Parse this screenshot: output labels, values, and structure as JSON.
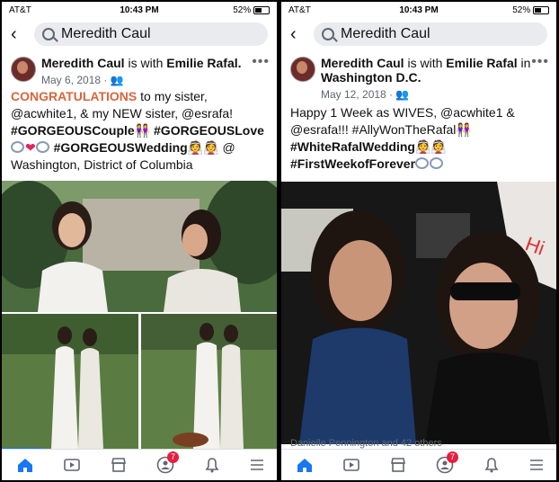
{
  "status": {
    "carrier": "AT&T",
    "time": "10:43 PM",
    "battery": "52%"
  },
  "search": {
    "query": "Meredith Caul"
  },
  "left": {
    "author": "Meredith Caul",
    "with_word": " is with ",
    "tagged": "Emilie Rafal.",
    "date": "May 6, 2018 · ",
    "text_congrats": "CONGRATULATIONS",
    "text_1": " to my sister, @acwhite1, & my NEW sister, @esrafa!",
    "tag_couple": "#GORGEOUSCouple",
    "tag_love": " #GORGEOUSLove",
    "tag_wedding": " #GORGEOUSWedding",
    "at": " @",
    "location": "Washington, District of Columbia"
  },
  "right": {
    "author": "Meredith Caul",
    "with_word": " is with ",
    "tagged": "Emilie Rafal",
    "in_word": " in ",
    "place": "Washington D.C.",
    "date": "May 12, 2018 · ",
    "text_1": "Happy 1 Week as WIVES, @acwhite1 &",
    "text_2": "@esrafa!!! #AllyWonTheRafal",
    "tag_1": "#WhiteRafalWedding",
    "tag_2": "#FirstWeekofForever",
    "likes": "Danielle Pennington and 42 others"
  },
  "tabs": {
    "groups_badge": "7"
  },
  "icons": [
    "back-arrow-icon",
    "search-icon",
    "more-icon",
    "globe-audience-icon",
    "home-icon",
    "watch-icon",
    "marketplace-icon",
    "groups-icon",
    "notifications-bell-icon",
    "menu-icon"
  ],
  "colors": {
    "accent": "#1877f2",
    "congrats": "#d9653b",
    "badge": "#e41e3f"
  }
}
